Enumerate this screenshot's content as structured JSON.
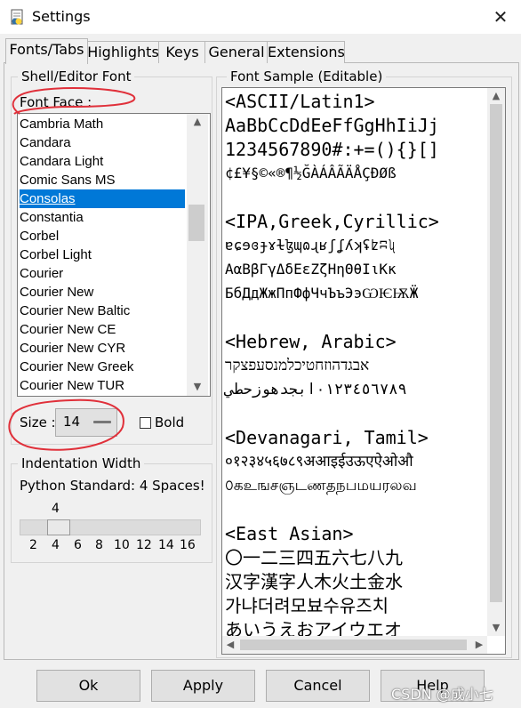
{
  "window": {
    "title": "Settings",
    "close": "✕"
  },
  "tabs": [
    "Fonts/Tabs",
    "Highlights",
    "Keys",
    "General",
    "Extensions"
  ],
  "font_group": {
    "title": "Shell/Editor Font",
    "font_face_label": "Font Face :",
    "fonts": [
      "Cambria Math",
      "Candara",
      "Candara Light",
      "Comic Sans MS",
      "Consolas",
      "Constantia",
      "Corbel",
      "Corbel Light",
      "Courier",
      "Courier New",
      "Courier New Baltic",
      "Courier New CE",
      "Courier New CYR",
      "Courier New Greek",
      "Courier New TUR"
    ],
    "selected_font": "Consolas",
    "size_label": "Size :",
    "size_value": "14",
    "bold_label": "Bold",
    "bold_checked": false
  },
  "indent_group": {
    "title": "Indentation Width",
    "python_standard": "Python Standard: 4 Spaces!",
    "slider_value": "4",
    "slider_ticks": [
      "2",
      "4",
      "6",
      "8",
      "10",
      "12",
      "14",
      "16"
    ]
  },
  "sample_group": {
    "title": "Font Sample (Editable)",
    "lines": [
      "<ASCII/Latin1>",
      "AaBbCcDdEeFfGgHhIiJj",
      "1234567890#:+=(){}[]",
      "¢£¥§©«®¶½ĞÀÁÂÃÄÅÇÐØß",
      "",
      "<IPA,Greek,Cyrillic>",
      "ɐɕɘɞɟɤɫɮɰɷɻʁʃʆʎʞʢʫʭʯ",
      "ΑαΒβΓγΔδΕεΖζΗηΘθΙιΚκ",
      "БбДдЖжПпФфЧчЪъЭэѠѤѬӜ",
      "",
      "<Hebrew, Arabic>",
      "אבגדהוזחטיכלמנסעפצקר",
      "٠١٢٣٤٥٦٧٨٩ابجدهوزحطي",
      "",
      "<Devanagari, Tamil>",
      "०१२३४५६७८९अआइईउऊएऐओऔ",
      "௦கஉஙசஞடணதநபமயரலவ",
      "",
      "<East Asian>",
      "〇一二三四五六七八九",
      "汉字漢字人木火土金水",
      "가냐더려모뵤수유즈치",
      "あいうえおアイウエオ"
    ]
  },
  "buttons": {
    "ok": "Ok",
    "apply": "Apply",
    "cancel": "Cancel",
    "help": "Help"
  },
  "watermark": "CSDN @成小七",
  "colors": {
    "selection": "#0078d7",
    "annotation_circle": "#e0303a"
  }
}
